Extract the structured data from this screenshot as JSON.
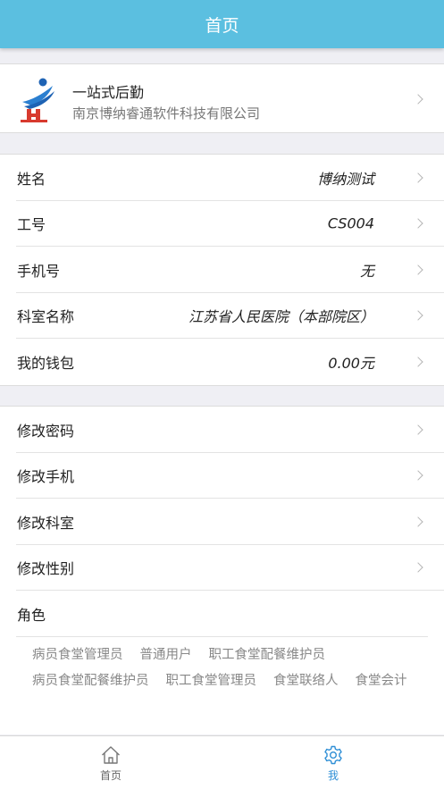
{
  "header": {
    "title": "首页"
  },
  "org": {
    "name": "一站式后勤",
    "company": "南京博纳睿通软件科技有限公司"
  },
  "profile": {
    "rows": [
      {
        "label": "姓名",
        "value": "博纳测试"
      },
      {
        "label": "工号",
        "value": "CS004"
      },
      {
        "label": "手机号",
        "value": "无"
      },
      {
        "label": "科室名称",
        "value": "江苏省人民医院（本部院区）"
      },
      {
        "label": "我的钱包",
        "value": "0.00元"
      }
    ]
  },
  "settings": {
    "rows": [
      {
        "label": "修改密码"
      },
      {
        "label": "修改手机"
      },
      {
        "label": "修改科室"
      },
      {
        "label": "修改性别"
      }
    ],
    "roles_label": "角色",
    "roles": [
      "病员食堂管理员",
      "普通用户",
      "职工食堂配餐维护员",
      "病员食堂配餐维护员",
      "职工食堂管理员",
      "食堂联络人",
      "食堂会计"
    ]
  },
  "tabbar": {
    "home_label": "首页",
    "me_label": "我",
    "home_icon": "home-icon",
    "me_icon": "gear-icon",
    "active_color": "#2f8fd6"
  },
  "colors": {
    "header_bg": "#5bbfe0",
    "page_bg": "#efeff4"
  }
}
